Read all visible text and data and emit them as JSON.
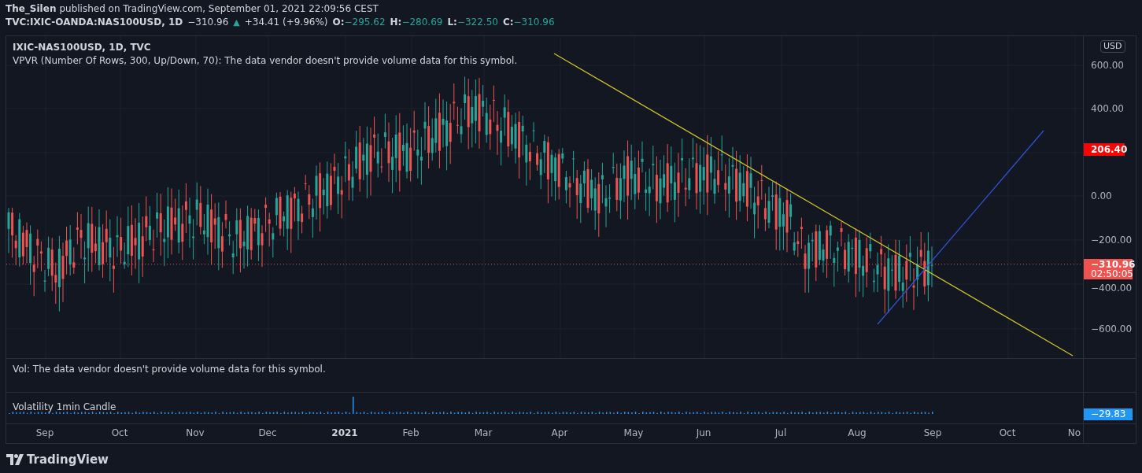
{
  "header": {
    "author": "The_Silen",
    "published": "published on TradingView.com, September 01, 2021 22:09:56 CEST",
    "symbol": "TVC:IXIC-OANDA:NAS100USD, 1D",
    "last": "−310.96",
    "arrow": "▲",
    "change": "+34.41 (+9.96%)",
    "ohlc": [
      {
        "label": "O:",
        "value": "−295.62"
      },
      {
        "label": "H:",
        "value": "−280.69"
      },
      {
        "label": "L:",
        "value": "−322.50"
      },
      {
        "label": "C:",
        "value": "−310.96"
      }
    ]
  },
  "main_pane": {
    "title": "IXIC-NAS100USD, 1D, TVC",
    "note": "VPVR (Number Of Rows, 300, Up/Down, 70): The data vendor doesn't provide volume data for this symbol.",
    "currency": "USD",
    "price_ticks": [
      "600.00",
      "400.00",
      "0.00",
      "−200.00",
      "−400.00",
      "−600.00"
    ],
    "level_badge": "206.40",
    "last_badge": {
      "price": "−310.96",
      "countdown": "02:50:05"
    }
  },
  "volume_pane": {
    "note": "Vol: The data vendor doesn't provide volume data for this symbol."
  },
  "volatility_pane": {
    "title": "Volatility 1min Candle",
    "reading": "−29.83"
  },
  "time_axis": [
    "Sep",
    "Oct",
    "Nov",
    "Dec",
    "2021",
    "Feb",
    "Mar",
    "Apr",
    "May",
    "Jun",
    "Jul",
    "Aug",
    "Sep",
    "Oct",
    "No"
  ],
  "footer": {
    "logo": "TradingView"
  }
}
